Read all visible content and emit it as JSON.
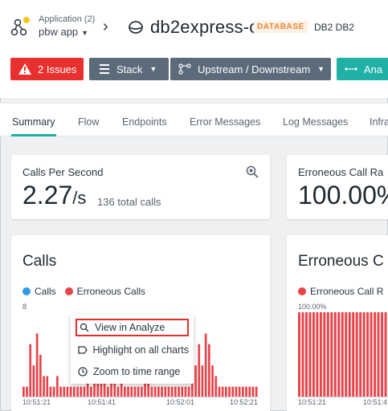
{
  "header": {
    "app_caption": "Application (2)",
    "app_name": "pbw app",
    "db_title": "db2express-c",
    "db_badge": "DATABASE",
    "db_type": "DB2 DB2"
  },
  "toolbar": {
    "issues_label": "2 Issues",
    "stack_label": "Stack",
    "updown_label": "Upstream / Downstream",
    "analyze_label": "Ana"
  },
  "tabs": [
    "Summary",
    "Flow",
    "Endpoints",
    "Error Messages",
    "Log Messages",
    "Infra"
  ],
  "active_tab": "Summary",
  "metrics": {
    "calls_label": "Calls Per Second",
    "calls_value": "2.27",
    "calls_unit": "/s",
    "calls_total": "136 total calls",
    "err_label": "Erroneous Call Ra",
    "err_value": "100.00%"
  },
  "calls_chart": {
    "title": "Calls",
    "legend_calls": "Calls",
    "legend_err": "Erroneous Calls",
    "ymax_label": "8"
  },
  "err_chart": {
    "title": "Erroneous C",
    "legend_err": "Erroneous Call R",
    "ymax_label": "100.00%"
  },
  "context_menu": {
    "view_analyze": "View in Analyze",
    "highlight": "Highlight on all charts",
    "zoom_range": "Zoom to time range"
  },
  "colors": {
    "calls": "#2d9be8",
    "erroneous": "#e8444a",
    "accent": "#1fb0a6",
    "issues": "#e8302f"
  },
  "icons": {
    "app": "app-nodes-icon",
    "database": "database-icon",
    "warning": "warning-icon",
    "stack": "stack-icon",
    "upstream": "topology-icon",
    "analyze": "analyze-icon",
    "zoom": "zoom-icon"
  },
  "chart_data": [
    {
      "type": "bar",
      "title": "Calls",
      "series": [
        {
          "name": "Calls",
          "values": [
            1,
            1,
            5,
            3,
            6,
            4,
            2,
            2,
            1,
            1,
            2,
            1,
            1,
            1,
            1,
            1,
            1,
            1,
            1,
            2,
            1,
            3,
            4,
            2,
            2,
            1,
            3,
            4,
            1,
            2,
            1,
            1,
            1,
            1,
            1,
            1,
            2,
            2,
            1,
            1,
            1,
            1,
            1,
            1,
            1,
            1,
            1,
            1,
            1,
            1,
            2,
            3,
            5,
            3,
            6,
            5,
            3,
            2,
            1,
            1,
            1,
            1,
            1,
            1,
            1,
            1,
            1,
            1,
            1,
            1
          ]
        },
        {
          "name": "Erroneous Calls",
          "values": [
            1,
            1,
            5,
            3,
            6,
            4,
            2,
            2,
            1,
            1,
            2,
            1,
            1,
            1,
            1,
            1,
            1,
            1,
            1,
            2,
            1,
            3,
            4,
            2,
            2,
            1,
            3,
            4,
            1,
            2,
            1,
            1,
            1,
            1,
            1,
            1,
            2,
            2,
            1,
            1,
            1,
            1,
            1,
            1,
            1,
            1,
            1,
            1,
            1,
            1,
            2,
            3,
            5,
            3,
            6,
            5,
            3,
            2,
            1,
            1,
            1,
            1,
            1,
            1,
            1,
            1,
            1,
            1,
            1,
            1
          ]
        }
      ],
      "ylim": [
        0,
        8
      ],
      "xtick_labels": [
        "10:51:21",
        "10:51:41",
        "10:52:01",
        "10:52:21"
      ]
    },
    {
      "type": "bar",
      "title": "Erroneous C",
      "series": [
        {
          "name": "Erroneous Call R",
          "values": [
            100,
            100,
            100,
            100,
            100,
            100,
            100,
            100,
            100,
            100,
            100,
            100,
            100,
            100,
            100,
            100,
            100,
            100,
            100,
            100,
            100,
            100,
            100,
            100,
            100
          ]
        }
      ],
      "ylim": [
        0,
        100
      ],
      "xtick_labels": [
        "10:51:21",
        "10:51:4"
      ]
    }
  ]
}
